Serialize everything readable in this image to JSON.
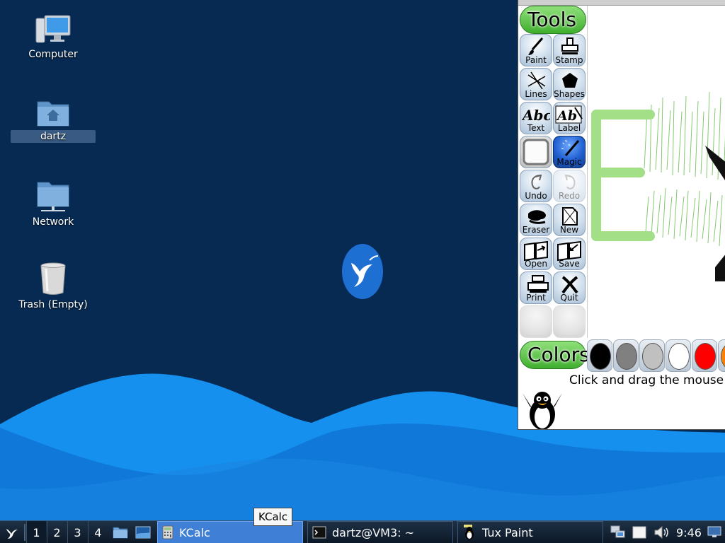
{
  "desktop": {
    "icons": [
      {
        "label": "Computer",
        "icon": "computer-icon"
      },
      {
        "label": "dartz",
        "icon": "home-folder-icon"
      },
      {
        "label": "Network",
        "icon": "network-folder-icon"
      },
      {
        "label": "Trash (Empty)",
        "icon": "trash-icon"
      }
    ],
    "logo_icon": "hummingbird-logo-icon",
    "colors": {
      "background": "#062a52",
      "wave_light": "#1a8ff0",
      "wave_mid": "#0f6cc6"
    }
  },
  "tuxpaint": {
    "tools_title": "Tools",
    "colors_title": "Colors",
    "tools": [
      {
        "label": "Paint",
        "icon": "paintbrush-icon"
      },
      {
        "label": "Stamp",
        "icon": "stamp-icon"
      },
      {
        "label": "Lines",
        "icon": "lines-icon"
      },
      {
        "label": "Shapes",
        "icon": "pentagon-icon"
      },
      {
        "label": "Text",
        "icon": "text-abc-icon"
      },
      {
        "label": "Label",
        "icon": "label-abc-icon"
      },
      {
        "label": "",
        "icon": "blank-square-icon"
      },
      {
        "label": "Magic",
        "icon": "magic-wand-icon"
      },
      {
        "label": "Undo",
        "icon": "undo-icon"
      },
      {
        "label": "Redo",
        "icon": "redo-icon"
      },
      {
        "label": "Eraser",
        "icon": "eraser-icon"
      },
      {
        "label": "New",
        "icon": "new-page-icon"
      },
      {
        "label": "Open",
        "icon": "open-book-icon"
      },
      {
        "label": "Save",
        "icon": "save-book-icon"
      },
      {
        "label": "Print",
        "icon": "printer-icon"
      },
      {
        "label": "Quit",
        "icon": "quit-x-icon"
      }
    ],
    "active_tool": "Magic",
    "swatches": [
      "#000000",
      "#808080",
      "#c0c0c0",
      "#ffffff",
      "#ff0000",
      "#ff8000"
    ],
    "hint": "Click and drag the mouse"
  },
  "tooltip": {
    "text": "KCalc"
  },
  "taskbar": {
    "start_icon": "hummingbird-start-icon",
    "workspaces": [
      "1",
      "2",
      "3",
      "4"
    ],
    "quicklaunch": [
      "file-manager-icon",
      "show-desktop-icon"
    ],
    "tasks": [
      {
        "label": "KCalc",
        "icon": "calculator-icon",
        "active": true
      },
      {
        "label": "dartz@VM3: ~",
        "icon": "terminal-icon",
        "active": false
      },
      {
        "label": "Tux Paint",
        "icon": "tuxpaint-app-icon",
        "active": false
      }
    ],
    "tray": [
      "network-tray-icon",
      "notes-tray-icon",
      "volume-icon"
    ],
    "clock": "9:46",
    "desktop_icon": "monitor-tray-icon"
  }
}
